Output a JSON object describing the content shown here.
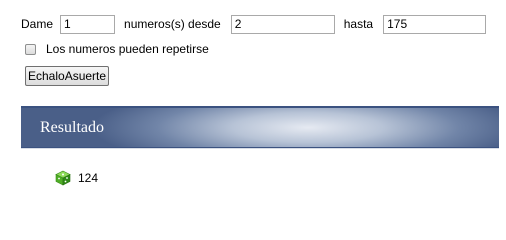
{
  "form": {
    "dame_label": "Dame",
    "count_value": "1",
    "numeros_label": "numeros(s) desde",
    "from_value": "2",
    "hasta_label": "hasta",
    "to_value": "175",
    "repeat_label": "Los numeros pueden repetirse",
    "repeat_checked": false,
    "submit_label": "EchaloAsuerte"
  },
  "results": {
    "title": "Resultado",
    "items": [
      "124"
    ],
    "icon": "dice-icon"
  },
  "colors": {
    "header_dark": "#4a5f88",
    "header_light": "#e6eaf2",
    "icon_green": "#5cb82e"
  }
}
